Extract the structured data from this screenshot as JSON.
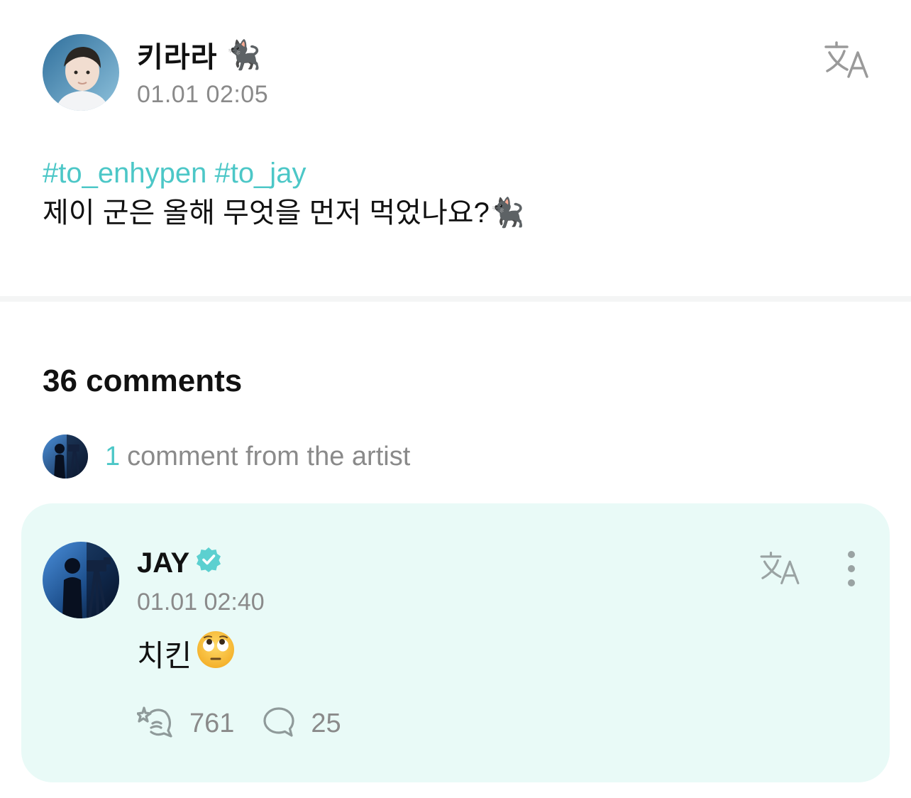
{
  "post": {
    "author": "키라라",
    "author_emoji": "🐈‍⬛",
    "time": "01.01 02:05",
    "hashtags": [
      "#to_enhypen",
      "#to_jay"
    ],
    "text": "제이 군은 올해 무엇을 먼저 먹었나요?",
    "text_emoji": "🐈‍⬛"
  },
  "comments": {
    "count_label": "36 comments",
    "artist_count": "1",
    "artist_label": "comment from the artist"
  },
  "artist_comment": {
    "name": "JAY",
    "time": "01.01 02:40",
    "text": "치킨",
    "text_emoji": "🙄",
    "likes": "761",
    "replies": "25"
  },
  "colors": {
    "accent": "#4cc7c7",
    "card_bg": "#e9faf7",
    "muted": "#8a8a8a"
  },
  "icons": {
    "translate": "translate-icon",
    "verified": "verified-badge-icon",
    "more": "more-vertical-icon",
    "like": "cheer-hand-icon",
    "reply": "speech-bubble-icon"
  }
}
